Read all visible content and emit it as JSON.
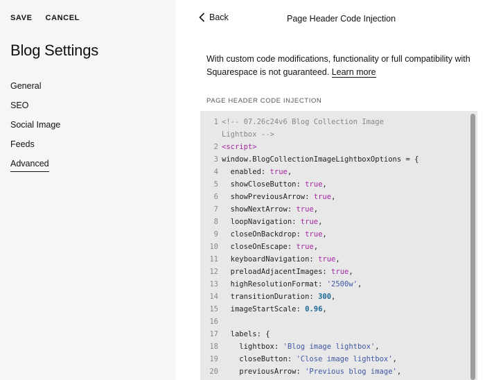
{
  "left_panel": {
    "save_label": "SAVE",
    "cancel_label": "CANCEL",
    "title": "Blog Settings",
    "nav": [
      {
        "label": "General"
      },
      {
        "label": "SEO"
      },
      {
        "label": "Social Image"
      },
      {
        "label": "Feeds"
      },
      {
        "label": "Advanced",
        "active": true
      }
    ]
  },
  "right_panel": {
    "back_label": "Back",
    "header_title": "Page Header Code Injection",
    "notice_line1": "With custom code modifications, functionality or full compatibility with",
    "notice_line2_prefix": "Squarespace is not guaranteed. ",
    "learn_more_label": "Learn more",
    "section_label": "PAGE HEADER CODE INJECTION"
  },
  "code": {
    "lines": [
      {
        "n": "1",
        "parts": [
          [
            "c",
            "<!-- 07.26c24v6 Blog Collection Image"
          ]
        ]
      },
      {
        "n": "",
        "parts": [
          [
            "c",
            "Lightbox -->"
          ]
        ]
      },
      {
        "n": "2",
        "parts": [
          [
            "tag",
            "<script>"
          ]
        ]
      },
      {
        "n": "3",
        "parts": [
          [
            "",
            "window.BlogCollectionImageLightboxOptions = {"
          ]
        ]
      },
      {
        "n": "4",
        "parts": [
          [
            "",
            "  enabled: "
          ],
          [
            "b",
            "true"
          ],
          [
            "",
            ","
          ]
        ]
      },
      {
        "n": "5",
        "parts": [
          [
            "",
            "  showCloseButton: "
          ],
          [
            "b",
            "true"
          ],
          [
            "",
            ","
          ]
        ]
      },
      {
        "n": "6",
        "parts": [
          [
            "",
            "  showPreviousArrow: "
          ],
          [
            "b",
            "true"
          ],
          [
            "",
            ","
          ]
        ]
      },
      {
        "n": "7",
        "parts": [
          [
            "",
            "  showNextArrow: "
          ],
          [
            "b",
            "true"
          ],
          [
            "",
            ","
          ]
        ]
      },
      {
        "n": "8",
        "parts": [
          [
            "",
            "  loopNavigation: "
          ],
          [
            "b",
            "true"
          ],
          [
            "",
            ","
          ]
        ]
      },
      {
        "n": "9",
        "parts": [
          [
            "",
            "  closeOnBackdrop: "
          ],
          [
            "b",
            "true"
          ],
          [
            "",
            ","
          ]
        ]
      },
      {
        "n": "10",
        "parts": [
          [
            "",
            "  closeOnEscape: "
          ],
          [
            "b",
            "true"
          ],
          [
            "",
            ","
          ]
        ]
      },
      {
        "n": "11",
        "parts": [
          [
            "",
            "  keyboardNavigation: "
          ],
          [
            "b",
            "true"
          ],
          [
            "",
            ","
          ]
        ]
      },
      {
        "n": "12",
        "parts": [
          [
            "",
            "  preloadAdjacentImages: "
          ],
          [
            "b",
            "true"
          ],
          [
            "",
            ","
          ]
        ]
      },
      {
        "n": "13",
        "parts": [
          [
            "",
            "  highResolutionFormat: "
          ],
          [
            "s",
            "'2500w'"
          ],
          [
            "",
            ","
          ]
        ]
      },
      {
        "n": "14",
        "parts": [
          [
            "",
            "  transitionDuration: "
          ],
          [
            "num",
            "300"
          ],
          [
            "",
            ","
          ]
        ]
      },
      {
        "n": "15",
        "parts": [
          [
            "",
            "  imageStartScale: "
          ],
          [
            "num",
            "0.96"
          ],
          [
            "",
            ","
          ]
        ]
      },
      {
        "n": "16",
        "parts": [
          [
            "",
            ""
          ]
        ]
      },
      {
        "n": "17",
        "parts": [
          [
            "",
            "  labels: {"
          ]
        ]
      },
      {
        "n": "18",
        "parts": [
          [
            "",
            "    lightbox: "
          ],
          [
            "s",
            "'Blog image lightbox'"
          ],
          [
            "",
            ","
          ]
        ]
      },
      {
        "n": "19",
        "parts": [
          [
            "",
            "    closeButton: "
          ],
          [
            "s",
            "'Close image lightbox'"
          ],
          [
            "",
            ","
          ]
        ]
      },
      {
        "n": "20",
        "parts": [
          [
            "",
            "    previousArrow: "
          ],
          [
            "s",
            "'Previous blog image'"
          ],
          [
            "",
            ","
          ]
        ]
      }
    ]
  },
  "colors": {
    "left_bg": "#f6f6f6",
    "code_bg": "#e8e8e8",
    "keyword": "#a626a4",
    "string": "#3e58a6",
    "number": "#1a6a9a"
  },
  "icons": {
    "back": "chevron-left-icon"
  }
}
